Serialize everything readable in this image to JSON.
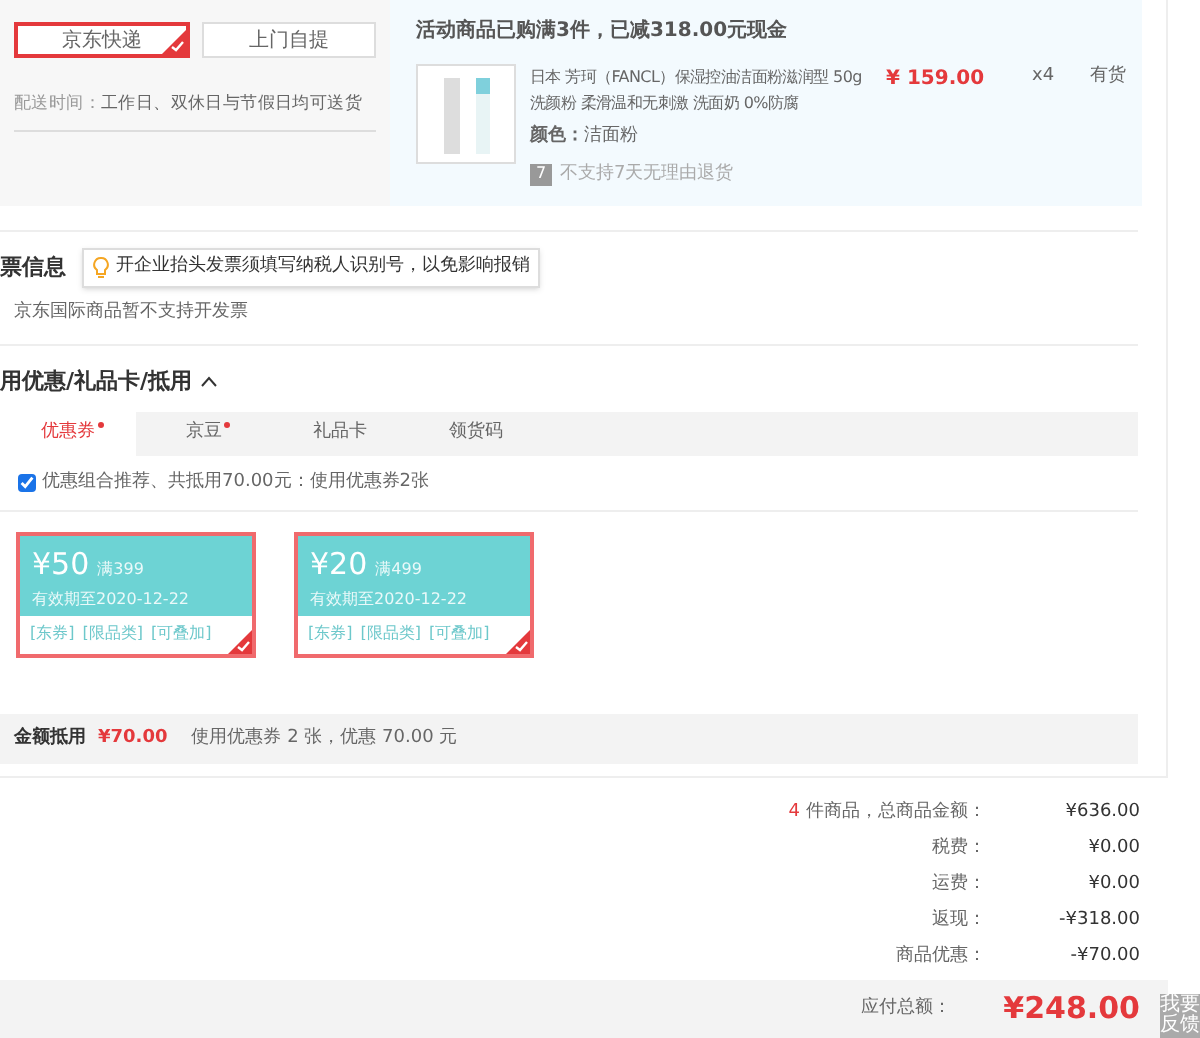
{
  "delivery": {
    "options": [
      {
        "label": "京东快递",
        "selected": true
      },
      {
        "label": "上门自提",
        "selected": false
      }
    ],
    "time_label": "配送时间：",
    "time_value": "工作日、双休日与节假日均可送货"
  },
  "order": {
    "promo": "活动商品已购满3件，已减318.00元现金",
    "product": {
      "title": "日本 芳珂（FANCL）保湿控油洁面粉滋润型 50g 洗颜粉 柔滑温和无刺激 洗面奶 0%防腐",
      "price": "¥ 159.00",
      "quantity": "x4",
      "stock": "有货",
      "color_label": "颜色：",
      "color_value": "洁面粉",
      "return_badge": "7",
      "return_note": "不支持7天无理由退货"
    }
  },
  "invoice": {
    "title": "票信息",
    "tip": "开企业抬头发票须填写纳税人识别号，以免影响报销",
    "note": "京东国际商品暂不支持开发票"
  },
  "discounts": {
    "title": "用优惠/礼品卡/抵用",
    "expanded": true,
    "tabs": [
      {
        "label": "优惠券",
        "selected": true,
        "dot": true
      },
      {
        "label": "京豆",
        "selected": false,
        "dot": true
      },
      {
        "label": "礼品卡",
        "selected": false,
        "dot": false
      },
      {
        "label": "领货码",
        "selected": false,
        "dot": false
      }
    ],
    "recommend": {
      "checked": true,
      "text": "优惠组合推荐、共抵用70.00元：使用优惠券2张"
    },
    "coupons": [
      {
        "amount": "¥50",
        "threshold": "满399",
        "expiry": "有效期至2020-12-22",
        "tags": [
          "[东券]",
          "[限品类]",
          "[可叠加]"
        ],
        "selected": true
      },
      {
        "amount": "¥20",
        "threshold": "满499",
        "expiry": "有效期至2020-12-22",
        "tags": [
          "[东券]",
          "[限品类]",
          "[可叠加]"
        ],
        "selected": true
      }
    ],
    "summary_label": "金额抵用",
    "summary_amount": "¥70.00",
    "summary_text": "使用优惠券 2 张，优惠 70.00 元"
  },
  "totals": {
    "rows": [
      {
        "count": "4",
        "label": "件商品，总商品金额：",
        "value": "¥636.00"
      },
      {
        "label": "税费：",
        "value": "¥0.00"
      },
      {
        "label": "运费：",
        "value": "¥0.00"
      },
      {
        "label": "返现：",
        "value": "-¥318.00"
      },
      {
        "label": "商品优惠：",
        "value": "-¥70.00"
      }
    ],
    "payable_label": "应付总额：",
    "payable_value": "¥248.00"
  },
  "feedback_button": "我要反馈"
}
